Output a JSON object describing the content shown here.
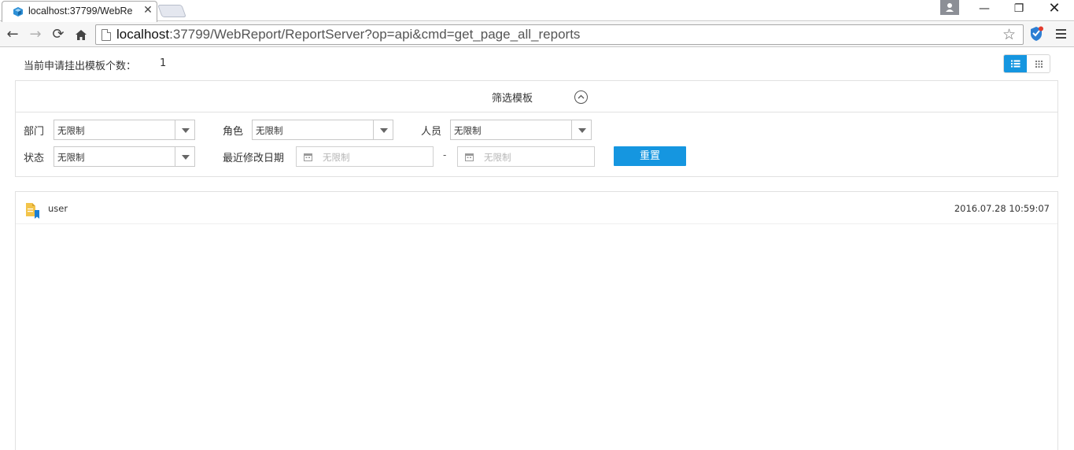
{
  "browser": {
    "tab_title": "localhost:37799/WebRe",
    "url_host": "localhost",
    "url_rest": ":37799/WebReport/ReportServer?op=api&cmd=get_page_all_reports"
  },
  "page": {
    "count_label": "当前申请挂出模板个数：",
    "count_value": "1",
    "filter": {
      "title": "筛选模板",
      "department_label": "部门",
      "department_value": "无限制",
      "role_label": "角色",
      "role_value": "无限制",
      "person_label": "人员",
      "person_value": "无限制",
      "status_label": "状态",
      "status_value": "无限制",
      "date_label": "最近修改日期",
      "date_from_placeholder": "无限制",
      "date_separator": "-",
      "date_to_placeholder": "无限制",
      "reset_label": "重置"
    },
    "reports": [
      {
        "name": "user",
        "modified": "2016.07.28 10:59:07"
      }
    ]
  },
  "colors": {
    "accent": "#1596e0",
    "border": "#e1e1e1"
  }
}
